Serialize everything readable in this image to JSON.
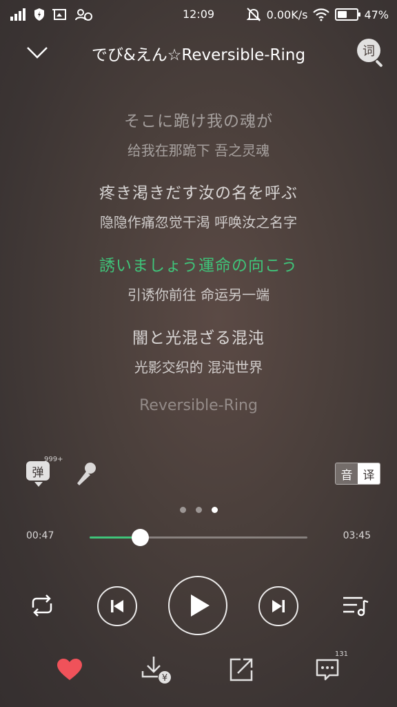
{
  "status_bar": {
    "time": "12:09",
    "network_speed": "0.00K/s",
    "battery_percent": "47%",
    "battery_level": 0.47
  },
  "header": {
    "title": "でび&えん☆Reversible-Ring",
    "lyric_search_label": "词"
  },
  "lyrics": [
    {
      "jp": "そこに跪け我の魂が",
      "cn": "给我在那跪下 吾之灵魂",
      "state": "dim"
    },
    {
      "jp": "疼き渇きだす汝の名を呼ぶ",
      "cn": "隐隐作痛忽觉干渴 呼唤汝之名字",
      "state": "normal"
    },
    {
      "jp": "誘いましょう運命の向こう",
      "cn": "引诱你前往 命运另一端",
      "state": "active"
    },
    {
      "jp": "闇と光混ざる混沌",
      "cn": "光影交织的 混沌世界",
      "state": "normal"
    }
  ],
  "lyrics_end_title": "Reversible-Ring",
  "tools": {
    "danmaku_label": "弹",
    "danmaku_count": "999+",
    "toggle_original": "音",
    "toggle_translation": "译"
  },
  "page_dots": {
    "count": 3,
    "active_index": 2
  },
  "playback": {
    "current_time": "00:47",
    "total_time": "03:45",
    "progress": 0.23
  },
  "bottom": {
    "comment_count": "131"
  },
  "colors": {
    "accent": "#3fc57a",
    "heart": "#f0525a"
  },
  "icons": {
    "back": "chevron-down-icon",
    "mic": "microphone-icon",
    "repeat": "repeat-icon",
    "prev": "skip-previous-icon",
    "play": "play-icon",
    "next": "skip-next-icon",
    "playlist": "playlist-icon",
    "like": "heart-icon",
    "download": "download-paid-icon",
    "share": "share-icon",
    "comment": "comment-icon"
  }
}
